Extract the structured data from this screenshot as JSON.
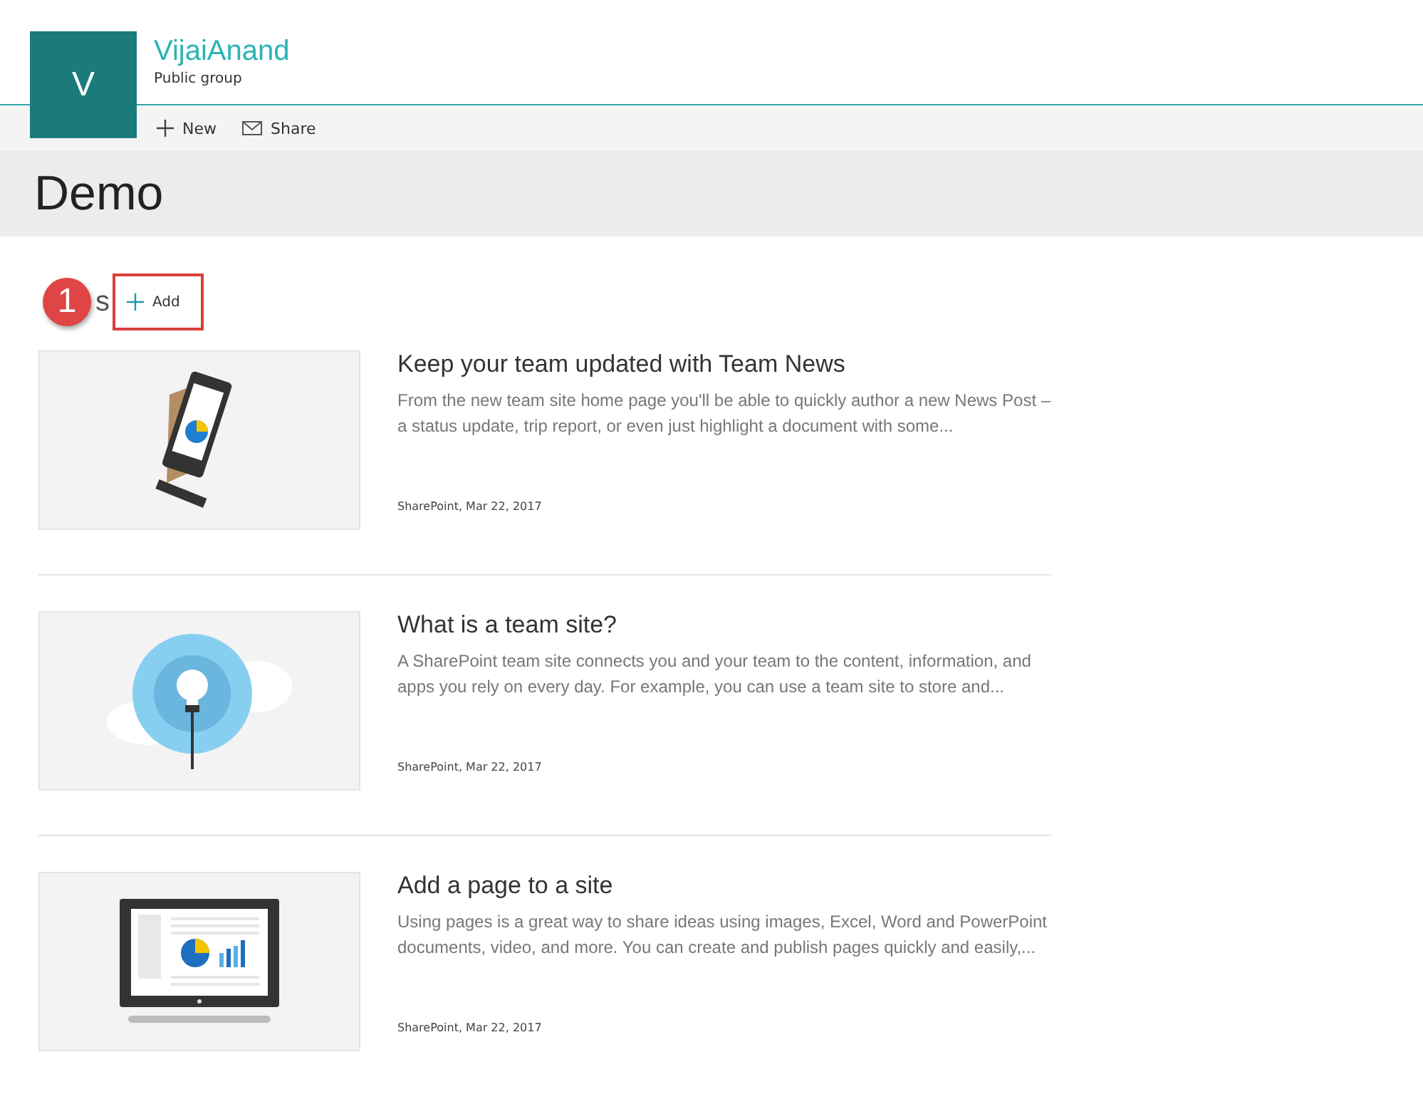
{
  "site": {
    "logo_letter": "V",
    "title": "VijaiAnand",
    "subtitle": "Public group"
  },
  "toolbar": [
    {
      "kind": "new",
      "label": "New"
    },
    {
      "kind": "share",
      "label": "Share"
    }
  ],
  "page_title": "Demo",
  "news": {
    "heading_visible": "s",
    "callout": "1",
    "add_label": "Add",
    "items": [
      {
        "kind": "phone",
        "title": "Keep your team updated with Team News",
        "description": "From the new team site home page you'll be able to quickly author a new News Post – a status update, trip report, or even just highlight a document with some...",
        "meta": "SharePoint, Mar 22, 2017"
      },
      {
        "kind": "lightbulb",
        "title": "What is a team site?",
        "description": "A SharePoint team site connects you and your team to the content, information, and apps you rely on every day. For example, you can use a team site to store and...",
        "meta": "SharePoint, Mar 22, 2017"
      },
      {
        "kind": "tablet",
        "title": "Add a page to a site",
        "description": "Using pages is a great way to share ideas using images, Excel, Word and PowerPoint documents, video, and more. You can create and publish pages quickly and easily,...",
        "meta": "SharePoint, Mar 22, 2017"
      }
    ]
  }
}
